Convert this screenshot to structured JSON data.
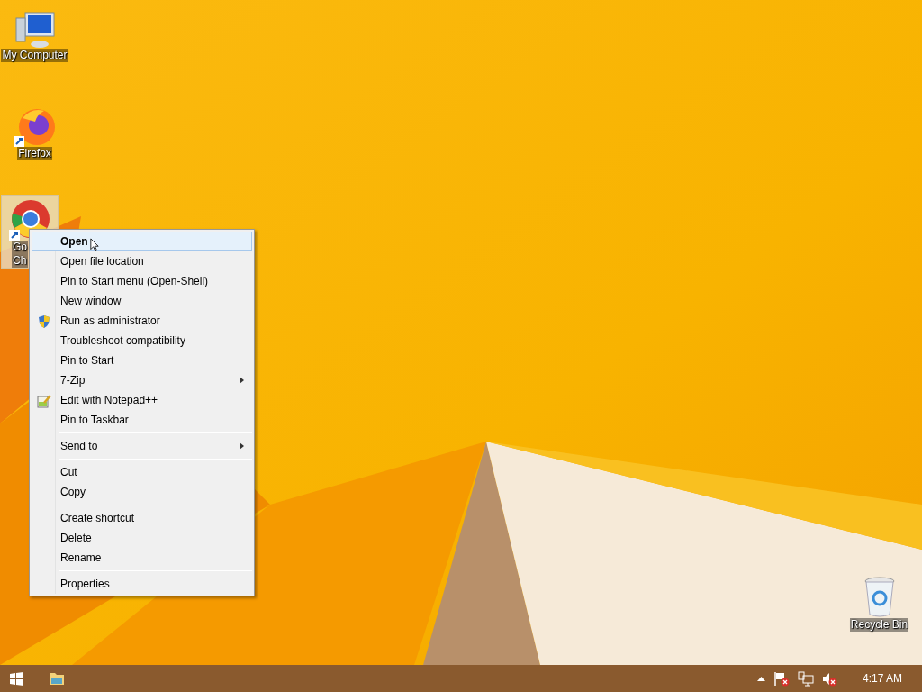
{
  "desktop_icons": [
    {
      "kind": "computer",
      "label_lines": [
        "My Computer"
      ],
      "selected": false,
      "shortcut": false
    },
    {
      "kind": "firefox",
      "label_lines": [
        "Firefox"
      ],
      "selected": false,
      "shortcut": true
    },
    {
      "kind": "chrome",
      "label_lines": [
        "Go",
        "Ch"
      ],
      "selected": true,
      "shortcut": true
    },
    {
      "kind": "recycle",
      "label_lines": [
        "Recycle Bin"
      ],
      "selected": false,
      "shortcut": false
    }
  ],
  "context_menu": {
    "items": [
      {
        "kind": "item",
        "label": "Open",
        "bold": true,
        "selected": true,
        "submenu": false
      },
      {
        "kind": "item",
        "label": "Open file location",
        "bold": false,
        "selected": false,
        "submenu": false
      },
      {
        "kind": "item",
        "label": "Pin to Start menu (Open-Shell)",
        "bold": false,
        "selected": false,
        "submenu": false
      },
      {
        "kind": "item",
        "label": "New window",
        "bold": false,
        "selected": false,
        "submenu": false
      },
      {
        "kind": "shield",
        "label": "Run as administrator",
        "bold": false,
        "selected": false,
        "submenu": false
      },
      {
        "kind": "item",
        "label": "Troubleshoot compatibility",
        "bold": false,
        "selected": false,
        "submenu": false
      },
      {
        "kind": "item",
        "label": "Pin to Start",
        "bold": false,
        "selected": false,
        "submenu": false
      },
      {
        "kind": "item",
        "label": "7-Zip",
        "bold": false,
        "selected": false,
        "submenu": true
      },
      {
        "kind": "notepad",
        "label": "Edit with Notepad++",
        "bold": false,
        "selected": false,
        "submenu": false
      },
      {
        "kind": "item",
        "label": "Pin to Taskbar",
        "bold": false,
        "selected": false,
        "submenu": false
      },
      {
        "kind": "separator"
      },
      {
        "kind": "item",
        "label": "Send to",
        "bold": false,
        "selected": false,
        "submenu": true
      },
      {
        "kind": "separator"
      },
      {
        "kind": "item",
        "label": "Cut",
        "bold": false,
        "selected": false,
        "submenu": false
      },
      {
        "kind": "item",
        "label": "Copy",
        "bold": false,
        "selected": false,
        "submenu": false
      },
      {
        "kind": "separator"
      },
      {
        "kind": "item",
        "label": "Create shortcut",
        "bold": false,
        "selected": false,
        "submenu": false
      },
      {
        "kind": "item",
        "label": "Delete",
        "bold": false,
        "selected": false,
        "submenu": false
      },
      {
        "kind": "item",
        "label": "Rename",
        "bold": false,
        "selected": false,
        "submenu": false
      },
      {
        "kind": "separator"
      },
      {
        "kind": "item",
        "label": "Properties",
        "bold": false,
        "selected": false,
        "submenu": false
      }
    ]
  },
  "taskbar": {
    "tray_icons": [
      {
        "kind": "caret"
      },
      {
        "kind": "flag"
      },
      {
        "kind": "network"
      },
      {
        "kind": "speaker"
      }
    ],
    "clock": "4:17 AM"
  }
}
